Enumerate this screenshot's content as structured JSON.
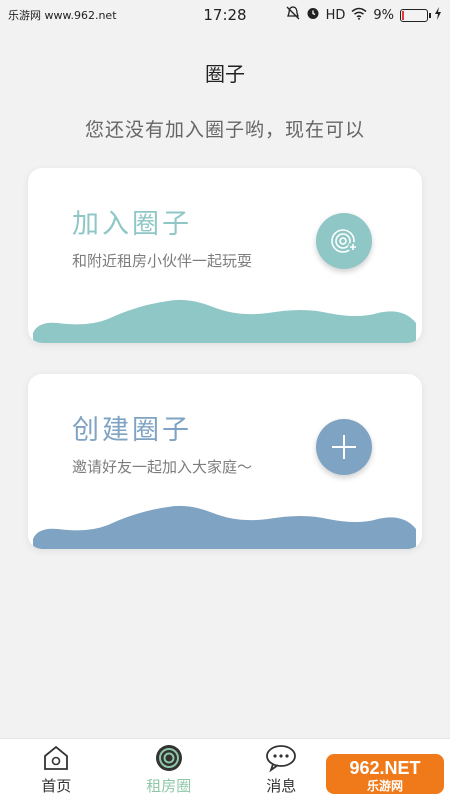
{
  "status_bar": {
    "left_text": "乐游网 www.962.net",
    "time": "17:28",
    "hd": "HD",
    "battery": "9%",
    "battery_level": 0.09
  },
  "header": {
    "title": "圈子",
    "subtitle": "您还没有加入圈子哟，现在可以"
  },
  "cards": [
    {
      "title": "加入圈子",
      "description": "和附近租房小伙伴一起玩耍",
      "color": "#8fc7c7",
      "icon": "join-circle-icon"
    },
    {
      "title": "创建圈子",
      "description": "邀请好友一起加入大家庭～",
      "color": "#7fa3c3",
      "icon": "plus-icon"
    }
  ],
  "tabbar": {
    "items": [
      {
        "label": "首页",
        "icon": "home-icon",
        "active": false
      },
      {
        "label": "租房圈",
        "icon": "circle-icon",
        "active": true
      },
      {
        "label": "消息",
        "icon": "message-icon",
        "active": false
      },
      {
        "label": "",
        "icon": "profile-icon",
        "active": false
      }
    ],
    "active_color": "#8fc7a7"
  },
  "watermark": {
    "text_top": "962.NET",
    "text_bottom": "乐游网"
  }
}
